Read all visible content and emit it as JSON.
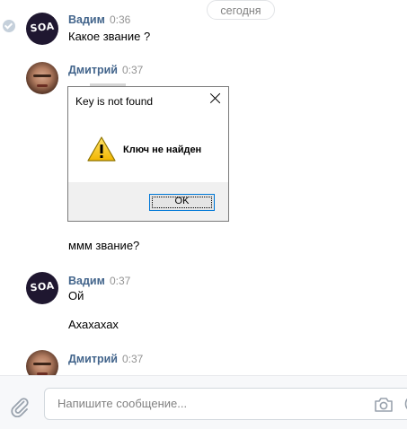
{
  "date_divider": "сегодня",
  "messages": [
    {
      "author": "Вадим",
      "time": "0:36",
      "avatar_text": "SOA",
      "lines": [
        "Какое звание ?"
      ]
    },
    {
      "author": "Дмитрий",
      "time": "0:37",
      "lines": [
        "ммм звание?"
      ]
    },
    {
      "author": "Вадим",
      "time": "0:37",
      "avatar_text": "SOA",
      "lines": [
        "Ой",
        "Ахахахах"
      ]
    },
    {
      "author": "Дмитрий",
      "time": "0:37",
      "lines": []
    }
  ],
  "dialog": {
    "title": "Key is not found",
    "message": "Ключ не найден",
    "ok_label": "OK"
  },
  "composer": {
    "placeholder": "Напишите сообщение..."
  },
  "icons": {
    "attach": "paperclip-icon",
    "camera": "camera-icon",
    "emoji": "smile-icon",
    "warning": "warning-icon",
    "close": "close-icon"
  },
  "colors": {
    "author_name": "#42648b",
    "time": "#939393",
    "accent_border": "#0078d7"
  }
}
